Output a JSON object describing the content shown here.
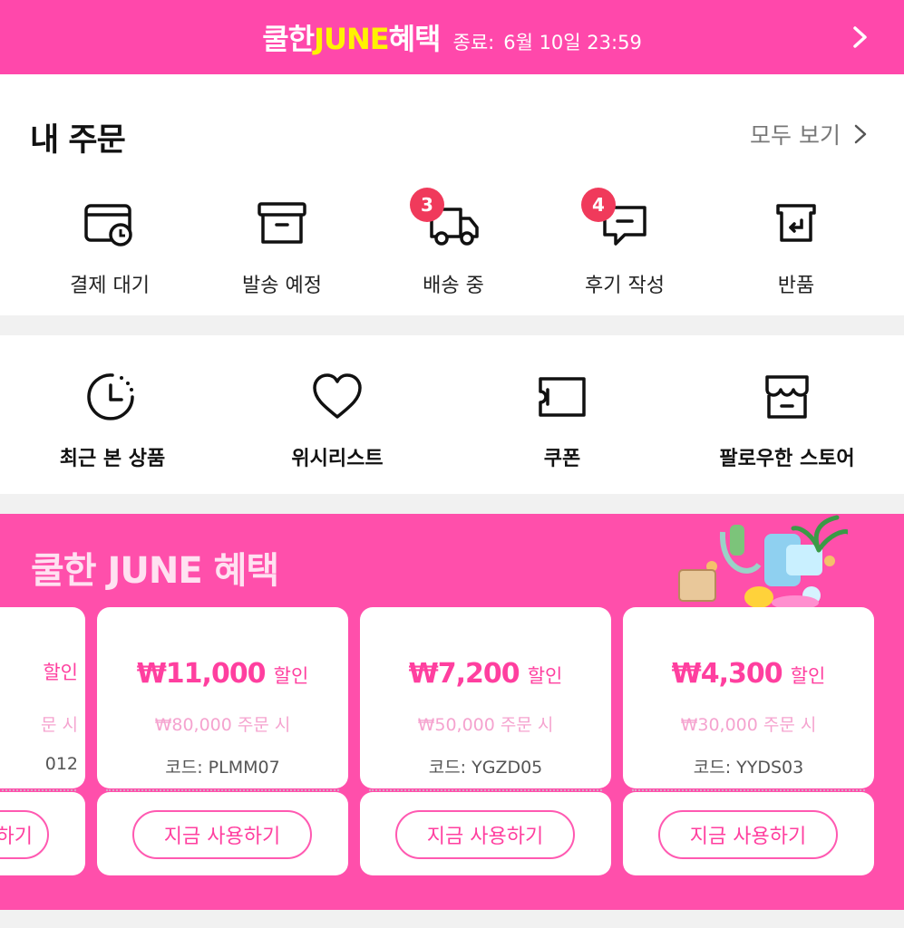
{
  "banner": {
    "cool": "쿨한",
    "june": "JUNE",
    "benefit": "혜택",
    "ends_label": "종료:",
    "end_date": "6월 10일 23:59"
  },
  "orders": {
    "title": "내 주문",
    "see_all": "모두 보기",
    "items": [
      {
        "label": "결제 대기",
        "icon": "payment-pending-icon"
      },
      {
        "label": "발송 예정",
        "icon": "box-icon"
      },
      {
        "label": "배송 중",
        "icon": "truck-icon",
        "badge": "3"
      },
      {
        "label": "후기 작성",
        "icon": "review-icon",
        "badge": "4"
      },
      {
        "label": "반품",
        "icon": "return-icon"
      }
    ]
  },
  "shortcuts": {
    "items": [
      {
        "label": "최근 본 상품",
        "icon": "clock-icon"
      },
      {
        "label": "위시리스트",
        "icon": "heart-icon"
      },
      {
        "label": "쿠폰",
        "icon": "coupon-icon"
      },
      {
        "label": "팔로우한 스토어",
        "icon": "store-icon"
      }
    ]
  },
  "promo": {
    "title": "쿨한 JUNE 혜택",
    "coupons": [
      {
        "amount": "",
        "off": "할인",
        "min_order": "문 시",
        "code": "012",
        "button": "하기"
      },
      {
        "amount": "₩11,000",
        "off": "할인",
        "min_order": "₩80,000 주문 시",
        "code": "코드: PLMM07",
        "button": "지금 사용하기"
      },
      {
        "amount": "₩7,200",
        "off": "할인",
        "min_order": "₩50,000 주문 시",
        "code": "코드: YGZD05",
        "button": "지금 사용하기"
      },
      {
        "amount": "₩4,300",
        "off": "할인",
        "min_order": "₩30,000 주문 시",
        "code": "코드: YYDS03",
        "button": "지금 사용하기"
      }
    ]
  },
  "colors": {
    "brand_pink": "#ff48ab",
    "highlight_yellow": "#fff200",
    "badge_red": "#f03a5b"
  }
}
